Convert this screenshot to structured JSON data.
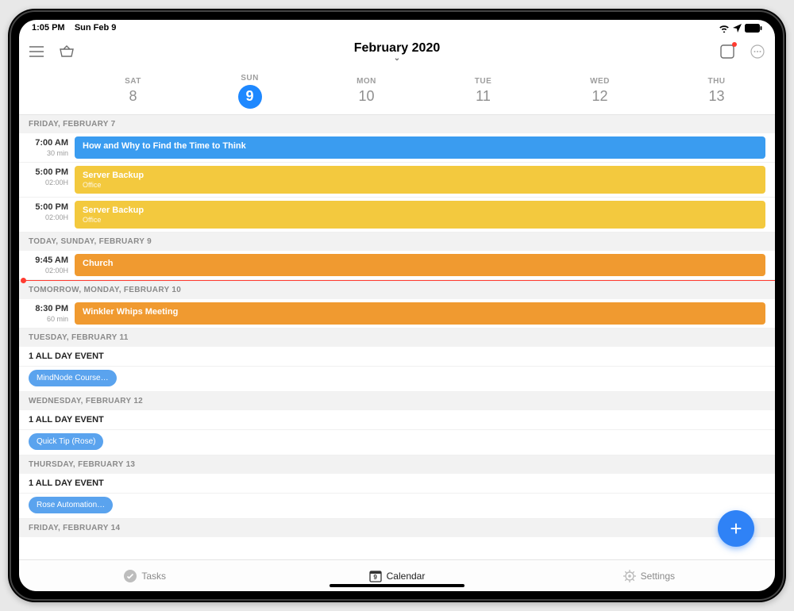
{
  "status": {
    "time": "1:05 PM",
    "date": "Sun Feb 9"
  },
  "header": {
    "title": "February 2020"
  },
  "week": [
    {
      "dow": "SAT",
      "num": "8",
      "today": false
    },
    {
      "dow": "SUN",
      "num": "9",
      "today": true
    },
    {
      "dow": "MON",
      "num": "10",
      "today": false
    },
    {
      "dow": "TUE",
      "num": "11",
      "today": false
    },
    {
      "dow": "WED",
      "num": "12",
      "today": false
    },
    {
      "dow": "THU",
      "num": "13",
      "today": false
    }
  ],
  "sections": [
    {
      "label": "FRIDAY, FEBRUARY 7",
      "rows": [
        {
          "time": "7:00 AM",
          "dur": "30 min",
          "title": "How and Why to Find the Time to Think",
          "sub": "",
          "color": "c-blue"
        },
        {
          "time": "5:00 PM",
          "dur": "02:00H",
          "title": "Server Backup",
          "sub": "Office",
          "color": "c-yellow"
        },
        {
          "time": "5:00 PM",
          "dur": "02:00H",
          "title": "Server Backup",
          "sub": "Office",
          "color": "c-yellow"
        }
      ]
    },
    {
      "label": "TODAY, SUNDAY, FEBRUARY 9",
      "nowline": true,
      "rows": [
        {
          "time": "9:45 AM",
          "dur": "02:00H",
          "title": "Church",
          "sub": "",
          "color": "c-orange"
        }
      ]
    },
    {
      "label": "TOMORROW, MONDAY, FEBRUARY 10",
      "rows": [
        {
          "time": "8:30 PM",
          "dur": "60 min",
          "title": "Winkler Whips Meeting",
          "sub": "",
          "color": "c-orange"
        }
      ]
    },
    {
      "label": "TUESDAY, FEBRUARY 11",
      "allday": "1 ALL DAY EVENT",
      "chip": "MindNode Course…"
    },
    {
      "label": "WEDNESDAY, FEBRUARY 12",
      "allday": "1 ALL DAY EVENT",
      "chip": "Quick Tip (Rose)"
    },
    {
      "label": "THURSDAY, FEBRUARY 13",
      "allday": "1 ALL DAY EVENT",
      "chip": "Rose Automation…"
    },
    {
      "label": "FRIDAY, FEBRUARY 14"
    }
  ],
  "tabs": {
    "tasks": "Tasks",
    "calendar": "Calendar",
    "calendar_day": "9",
    "settings": "Settings"
  }
}
